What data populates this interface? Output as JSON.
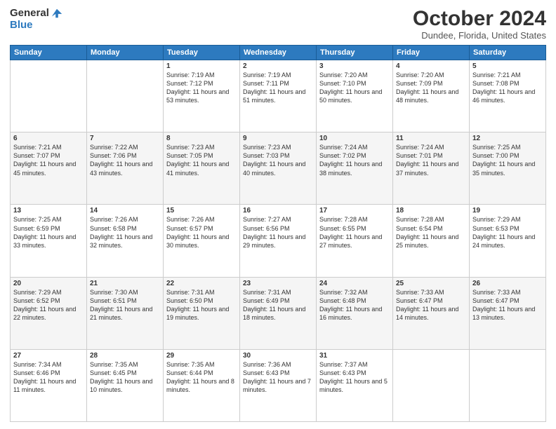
{
  "logo": {
    "line1": "General",
    "line2": "Blue"
  },
  "header": {
    "month": "October 2024",
    "location": "Dundee, Florida, United States"
  },
  "days": [
    "Sunday",
    "Monday",
    "Tuesday",
    "Wednesday",
    "Thursday",
    "Friday",
    "Saturday"
  ],
  "weeks": [
    [
      {
        "day": "",
        "sunrise": "",
        "sunset": "",
        "daylight": ""
      },
      {
        "day": "",
        "sunrise": "",
        "sunset": "",
        "daylight": ""
      },
      {
        "day": "1",
        "sunrise": "Sunrise: 7:19 AM",
        "sunset": "Sunset: 7:12 PM",
        "daylight": "Daylight: 11 hours and 53 minutes."
      },
      {
        "day": "2",
        "sunrise": "Sunrise: 7:19 AM",
        "sunset": "Sunset: 7:11 PM",
        "daylight": "Daylight: 11 hours and 51 minutes."
      },
      {
        "day": "3",
        "sunrise": "Sunrise: 7:20 AM",
        "sunset": "Sunset: 7:10 PM",
        "daylight": "Daylight: 11 hours and 50 minutes."
      },
      {
        "day": "4",
        "sunrise": "Sunrise: 7:20 AM",
        "sunset": "Sunset: 7:09 PM",
        "daylight": "Daylight: 11 hours and 48 minutes."
      },
      {
        "day": "5",
        "sunrise": "Sunrise: 7:21 AM",
        "sunset": "Sunset: 7:08 PM",
        "daylight": "Daylight: 11 hours and 46 minutes."
      }
    ],
    [
      {
        "day": "6",
        "sunrise": "Sunrise: 7:21 AM",
        "sunset": "Sunset: 7:07 PM",
        "daylight": "Daylight: 11 hours and 45 minutes."
      },
      {
        "day": "7",
        "sunrise": "Sunrise: 7:22 AM",
        "sunset": "Sunset: 7:06 PM",
        "daylight": "Daylight: 11 hours and 43 minutes."
      },
      {
        "day": "8",
        "sunrise": "Sunrise: 7:23 AM",
        "sunset": "Sunset: 7:05 PM",
        "daylight": "Daylight: 11 hours and 41 minutes."
      },
      {
        "day": "9",
        "sunrise": "Sunrise: 7:23 AM",
        "sunset": "Sunset: 7:03 PM",
        "daylight": "Daylight: 11 hours and 40 minutes."
      },
      {
        "day": "10",
        "sunrise": "Sunrise: 7:24 AM",
        "sunset": "Sunset: 7:02 PM",
        "daylight": "Daylight: 11 hours and 38 minutes."
      },
      {
        "day": "11",
        "sunrise": "Sunrise: 7:24 AM",
        "sunset": "Sunset: 7:01 PM",
        "daylight": "Daylight: 11 hours and 37 minutes."
      },
      {
        "day": "12",
        "sunrise": "Sunrise: 7:25 AM",
        "sunset": "Sunset: 7:00 PM",
        "daylight": "Daylight: 11 hours and 35 minutes."
      }
    ],
    [
      {
        "day": "13",
        "sunrise": "Sunrise: 7:25 AM",
        "sunset": "Sunset: 6:59 PM",
        "daylight": "Daylight: 11 hours and 33 minutes."
      },
      {
        "day": "14",
        "sunrise": "Sunrise: 7:26 AM",
        "sunset": "Sunset: 6:58 PM",
        "daylight": "Daylight: 11 hours and 32 minutes."
      },
      {
        "day": "15",
        "sunrise": "Sunrise: 7:26 AM",
        "sunset": "Sunset: 6:57 PM",
        "daylight": "Daylight: 11 hours and 30 minutes."
      },
      {
        "day": "16",
        "sunrise": "Sunrise: 7:27 AM",
        "sunset": "Sunset: 6:56 PM",
        "daylight": "Daylight: 11 hours and 29 minutes."
      },
      {
        "day": "17",
        "sunrise": "Sunrise: 7:28 AM",
        "sunset": "Sunset: 6:55 PM",
        "daylight": "Daylight: 11 hours and 27 minutes."
      },
      {
        "day": "18",
        "sunrise": "Sunrise: 7:28 AM",
        "sunset": "Sunset: 6:54 PM",
        "daylight": "Daylight: 11 hours and 25 minutes."
      },
      {
        "day": "19",
        "sunrise": "Sunrise: 7:29 AM",
        "sunset": "Sunset: 6:53 PM",
        "daylight": "Daylight: 11 hours and 24 minutes."
      }
    ],
    [
      {
        "day": "20",
        "sunrise": "Sunrise: 7:29 AM",
        "sunset": "Sunset: 6:52 PM",
        "daylight": "Daylight: 11 hours and 22 minutes."
      },
      {
        "day": "21",
        "sunrise": "Sunrise: 7:30 AM",
        "sunset": "Sunset: 6:51 PM",
        "daylight": "Daylight: 11 hours and 21 minutes."
      },
      {
        "day": "22",
        "sunrise": "Sunrise: 7:31 AM",
        "sunset": "Sunset: 6:50 PM",
        "daylight": "Daylight: 11 hours and 19 minutes."
      },
      {
        "day": "23",
        "sunrise": "Sunrise: 7:31 AM",
        "sunset": "Sunset: 6:49 PM",
        "daylight": "Daylight: 11 hours and 18 minutes."
      },
      {
        "day": "24",
        "sunrise": "Sunrise: 7:32 AM",
        "sunset": "Sunset: 6:48 PM",
        "daylight": "Daylight: 11 hours and 16 minutes."
      },
      {
        "day": "25",
        "sunrise": "Sunrise: 7:33 AM",
        "sunset": "Sunset: 6:47 PM",
        "daylight": "Daylight: 11 hours and 14 minutes."
      },
      {
        "day": "26",
        "sunrise": "Sunrise: 7:33 AM",
        "sunset": "Sunset: 6:47 PM",
        "daylight": "Daylight: 11 hours and 13 minutes."
      }
    ],
    [
      {
        "day": "27",
        "sunrise": "Sunrise: 7:34 AM",
        "sunset": "Sunset: 6:46 PM",
        "daylight": "Daylight: 11 hours and 11 minutes."
      },
      {
        "day": "28",
        "sunrise": "Sunrise: 7:35 AM",
        "sunset": "Sunset: 6:45 PM",
        "daylight": "Daylight: 11 hours and 10 minutes."
      },
      {
        "day": "29",
        "sunrise": "Sunrise: 7:35 AM",
        "sunset": "Sunset: 6:44 PM",
        "daylight": "Daylight: 11 hours and 8 minutes."
      },
      {
        "day": "30",
        "sunrise": "Sunrise: 7:36 AM",
        "sunset": "Sunset: 6:43 PM",
        "daylight": "Daylight: 11 hours and 7 minutes."
      },
      {
        "day": "31",
        "sunrise": "Sunrise: 7:37 AM",
        "sunset": "Sunset: 6:43 PM",
        "daylight": "Daylight: 11 hours and 5 minutes."
      },
      {
        "day": "",
        "sunrise": "",
        "sunset": "",
        "daylight": ""
      },
      {
        "day": "",
        "sunrise": "",
        "sunset": "",
        "daylight": ""
      }
    ]
  ]
}
